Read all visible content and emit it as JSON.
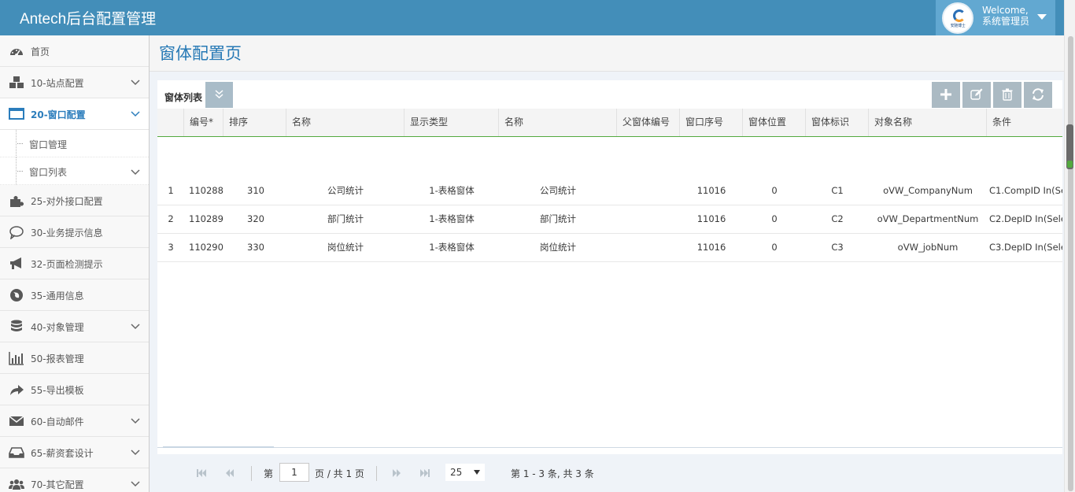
{
  "app": {
    "title": "Antech后台配置管理"
  },
  "user": {
    "welcome": "Welcome,",
    "name": "系统管理员",
    "avatar_text": "安驰博士"
  },
  "sidebar": {
    "items": [
      {
        "label": "首页",
        "icon": "dashboard-icon"
      },
      {
        "label": "10-站点配置",
        "icon": "cubes-icon",
        "expandable": true
      },
      {
        "label": "20-窗口配置",
        "icon": "desktop-icon",
        "expandable": true,
        "active": true
      },
      {
        "label": "25-对外接口配置",
        "icon": "puzzle-icon"
      },
      {
        "label": "30-业务提示信息",
        "icon": "comment-icon"
      },
      {
        "label": "32-页面检测提示",
        "icon": "bullhorn-icon"
      },
      {
        "label": "35-通用信息",
        "icon": "globe-icon"
      },
      {
        "label": "40-对象管理",
        "icon": "database-icon",
        "expandable": true
      },
      {
        "label": "50-报表管理",
        "icon": "bar-chart-icon"
      },
      {
        "label": "55-导出模板",
        "icon": "share-icon"
      },
      {
        "label": "60-自动邮件",
        "icon": "envelope-icon",
        "expandable": true
      },
      {
        "label": "65-薪资套设计",
        "icon": "inbox-icon",
        "expandable": true
      },
      {
        "label": "70-其它配置",
        "icon": "users-icon",
        "expandable": true
      }
    ],
    "sub_items": [
      {
        "label": "窗口管理"
      },
      {
        "label": "窗口列表",
        "expandable": true
      }
    ]
  },
  "page": {
    "title": "窗体配置页"
  },
  "grid": {
    "caption": "窗体列表",
    "toolbar": [
      "add-icon",
      "edit-icon",
      "delete-icon",
      "refresh-icon"
    ],
    "columns": [
      "编号*",
      "排序",
      "名称",
      "显示类型",
      "名称",
      "父窗体编号",
      "窗口序号",
      "窗体位置",
      "窗体标识",
      "对象名称",
      "条件"
    ],
    "rows": [
      {
        "rn": "1",
        "id": "110288",
        "sort": "310",
        "name": "公司统计",
        "type": "1-表格窗体",
        "name2": "公司统计",
        "parent": "",
        "seq": "11016",
        "pos": "0",
        "flag": "C1",
        "obj": "oVW_CompanyNum",
        "cond": "C1.CompID In(Se"
      },
      {
        "rn": "2",
        "id": "110289",
        "sort": "320",
        "name": "部门统计",
        "type": "1-表格窗体",
        "name2": "部门统计",
        "parent": "",
        "seq": "11016",
        "pos": "0",
        "flag": "C2",
        "obj": "oVW_DepartmentNum",
        "cond": "C2.DepID In(Sele"
      },
      {
        "rn": "3",
        "id": "110290",
        "sort": "330",
        "name": "岗位统计",
        "type": "1-表格窗体",
        "name2": "岗位统计",
        "parent": "",
        "seq": "11016",
        "pos": "0",
        "flag": "C3",
        "obj": "oVW_jobNum",
        "cond": "C3.DepID In(Sele"
      }
    ]
  },
  "pager": {
    "page_label": "第",
    "page_value": "1",
    "total_label": "页 / 共 1 页",
    "page_size": "25",
    "summary": "第 1 - 3 条, 共 3 条"
  },
  "colors": {
    "header": "#438eb9",
    "accent": "#2679b5",
    "active_line": "#53a93f"
  }
}
